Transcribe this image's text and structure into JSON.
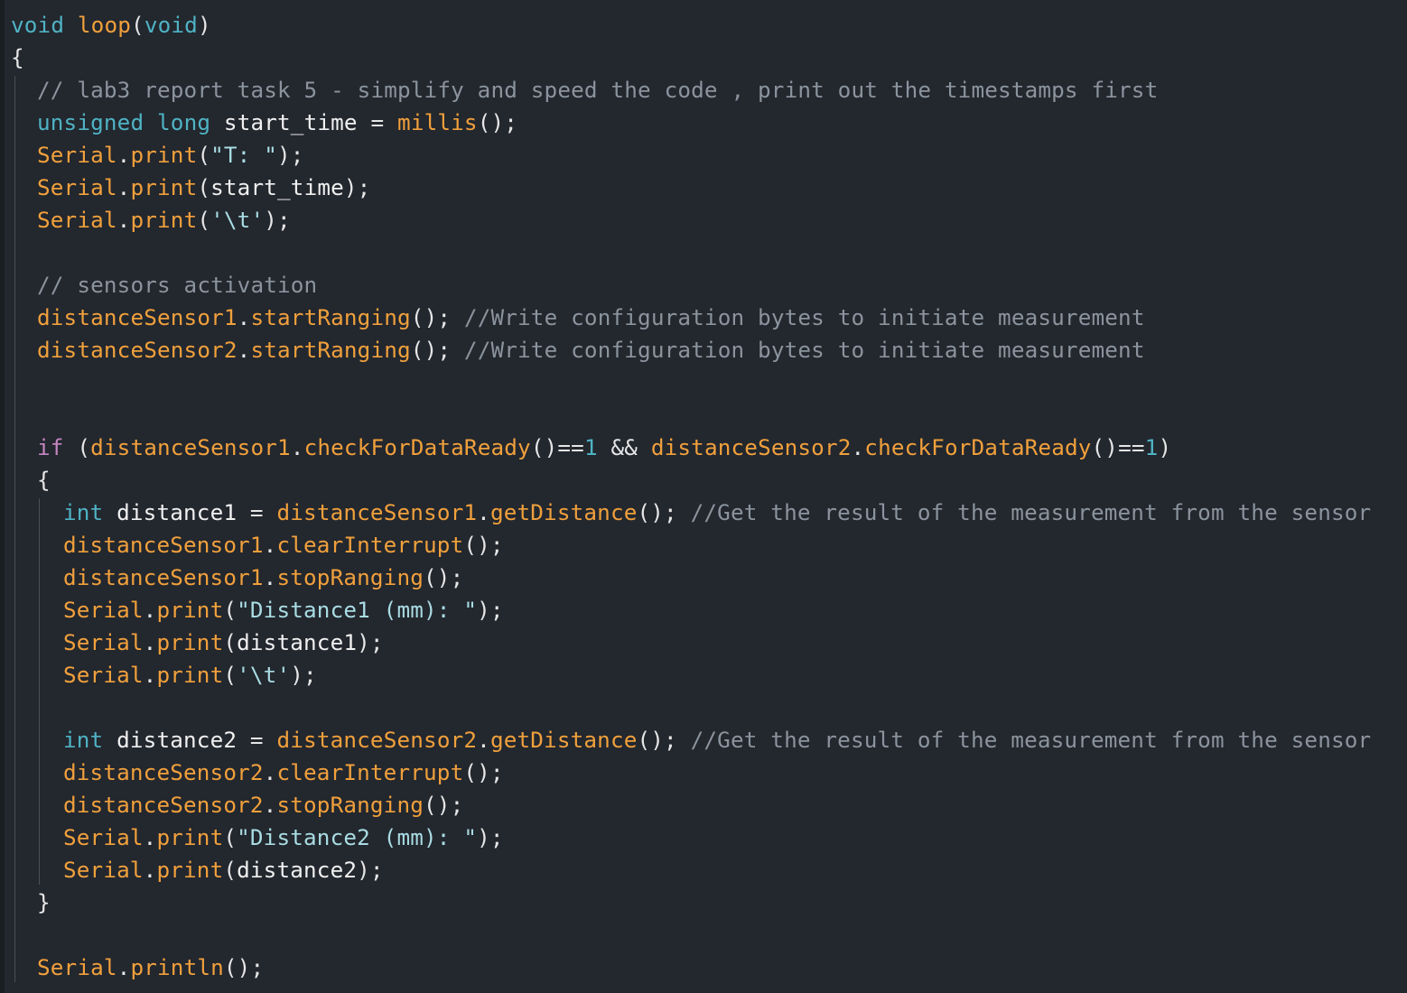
{
  "editor": {
    "language": "Arduino C++",
    "colors": {
      "background": "#23272e",
      "keyword": "#4fb3c4",
      "control": "#c586c0",
      "function": "#f0a03c",
      "comment": "#8b949e",
      "string": "#a9dce3",
      "number": "#4fb3c4",
      "plain": "#e6e6e6"
    },
    "lines": [
      {
        "indent": 0,
        "tokens": [
          [
            "kw",
            "void"
          ],
          [
            "ws",
            " "
          ],
          [
            "fn",
            "loop"
          ],
          [
            "pn",
            "("
          ],
          [
            "kw",
            "void"
          ],
          [
            "pn",
            ")"
          ]
        ]
      },
      {
        "indent": 0,
        "tokens": [
          [
            "pn",
            "{"
          ]
        ]
      },
      {
        "indent": 1,
        "tokens": [
          [
            "cm",
            "// lab3 report task 5 - simplify and speed the code , print out the timestamps first"
          ]
        ]
      },
      {
        "indent": 1,
        "tokens": [
          [
            "kw",
            "unsigned"
          ],
          [
            "ws",
            " "
          ],
          [
            "kw",
            "long"
          ],
          [
            "ws",
            " "
          ],
          [
            "id",
            "start_time"
          ],
          [
            "ws",
            " "
          ],
          [
            "op",
            "="
          ],
          [
            "ws",
            " "
          ],
          [
            "fn",
            "millis"
          ],
          [
            "pn",
            "();"
          ]
        ]
      },
      {
        "indent": 1,
        "tokens": [
          [
            "fn",
            "Serial"
          ],
          [
            "pn",
            "."
          ],
          [
            "fn",
            "print"
          ],
          [
            "pn",
            "("
          ],
          [
            "str",
            "\"T: \""
          ],
          [
            "pn",
            ");"
          ]
        ]
      },
      {
        "indent": 1,
        "tokens": [
          [
            "fn",
            "Serial"
          ],
          [
            "pn",
            "."
          ],
          [
            "fn",
            "print"
          ],
          [
            "pn",
            "("
          ],
          [
            "id",
            "start_time"
          ],
          [
            "pn",
            ");"
          ]
        ]
      },
      {
        "indent": 1,
        "tokens": [
          [
            "fn",
            "Serial"
          ],
          [
            "pn",
            "."
          ],
          [
            "fn",
            "print"
          ],
          [
            "pn",
            "("
          ],
          [
            "str",
            "'\\t'"
          ],
          [
            "pn",
            ");"
          ]
        ]
      },
      {
        "indent": 1,
        "tokens": []
      },
      {
        "indent": 1,
        "tokens": [
          [
            "cm",
            "// sensors activation"
          ]
        ]
      },
      {
        "indent": 1,
        "tokens": [
          [
            "fn",
            "distanceSensor1"
          ],
          [
            "pn",
            "."
          ],
          [
            "fn",
            "startRanging"
          ],
          [
            "pn",
            "();"
          ],
          [
            "ws",
            " "
          ],
          [
            "cm",
            "//Write configuration bytes to initiate measurement"
          ]
        ]
      },
      {
        "indent": 1,
        "tokens": [
          [
            "fn",
            "distanceSensor2"
          ],
          [
            "pn",
            "."
          ],
          [
            "fn",
            "startRanging"
          ],
          [
            "pn",
            "();"
          ],
          [
            "ws",
            " "
          ],
          [
            "cm",
            "//Write configuration bytes to initiate measurement"
          ]
        ]
      },
      {
        "indent": 1,
        "tokens": []
      },
      {
        "indent": 1,
        "tokens": []
      },
      {
        "indent": 1,
        "tokens": [
          [
            "ctl",
            "if"
          ],
          [
            "ws",
            " "
          ],
          [
            "pn",
            "("
          ],
          [
            "fn",
            "distanceSensor1"
          ],
          [
            "pn",
            "."
          ],
          [
            "fn",
            "checkForDataReady"
          ],
          [
            "pn",
            "()"
          ],
          [
            "op",
            "=="
          ],
          [
            "num",
            "1"
          ],
          [
            "ws",
            " "
          ],
          [
            "op",
            "&&"
          ],
          [
            "ws",
            " "
          ],
          [
            "fn",
            "distanceSensor2"
          ],
          [
            "pn",
            "."
          ],
          [
            "fn",
            "checkForDataReady"
          ],
          [
            "pn",
            "()"
          ],
          [
            "op",
            "=="
          ],
          [
            "num",
            "1"
          ],
          [
            "pn",
            ")"
          ]
        ]
      },
      {
        "indent": 1,
        "tokens": [
          [
            "pn",
            "{"
          ]
        ]
      },
      {
        "indent": 2,
        "tokens": [
          [
            "kw",
            "int"
          ],
          [
            "ws",
            " "
          ],
          [
            "id",
            "distance1"
          ],
          [
            "ws",
            " "
          ],
          [
            "op",
            "="
          ],
          [
            "ws",
            " "
          ],
          [
            "fn",
            "distanceSensor1"
          ],
          [
            "pn",
            "."
          ],
          [
            "fn",
            "getDistance"
          ],
          [
            "pn",
            "();"
          ],
          [
            "ws",
            " "
          ],
          [
            "cm",
            "//Get the result of the measurement from the sensor"
          ]
        ]
      },
      {
        "indent": 2,
        "tokens": [
          [
            "fn",
            "distanceSensor1"
          ],
          [
            "pn",
            "."
          ],
          [
            "fn",
            "clearInterrupt"
          ],
          [
            "pn",
            "();"
          ]
        ]
      },
      {
        "indent": 2,
        "tokens": [
          [
            "fn",
            "distanceSensor1"
          ],
          [
            "pn",
            "."
          ],
          [
            "fn",
            "stopRanging"
          ],
          [
            "pn",
            "();"
          ]
        ]
      },
      {
        "indent": 2,
        "tokens": [
          [
            "fn",
            "Serial"
          ],
          [
            "pn",
            "."
          ],
          [
            "fn",
            "print"
          ],
          [
            "pn",
            "("
          ],
          [
            "str",
            "\"Distance1 (mm): \""
          ],
          [
            "pn",
            ");"
          ]
        ]
      },
      {
        "indent": 2,
        "tokens": [
          [
            "fn",
            "Serial"
          ],
          [
            "pn",
            "."
          ],
          [
            "fn",
            "print"
          ],
          [
            "pn",
            "("
          ],
          [
            "id",
            "distance1"
          ],
          [
            "pn",
            ");"
          ]
        ]
      },
      {
        "indent": 2,
        "tokens": [
          [
            "fn",
            "Serial"
          ],
          [
            "pn",
            "."
          ],
          [
            "fn",
            "print"
          ],
          [
            "pn",
            "("
          ],
          [
            "str",
            "'\\t'"
          ],
          [
            "pn",
            ");"
          ]
        ]
      },
      {
        "indent": 2,
        "tokens": []
      },
      {
        "indent": 2,
        "tokens": [
          [
            "kw",
            "int"
          ],
          [
            "ws",
            " "
          ],
          [
            "id",
            "distance2"
          ],
          [
            "ws",
            " "
          ],
          [
            "op",
            "="
          ],
          [
            "ws",
            " "
          ],
          [
            "fn",
            "distanceSensor2"
          ],
          [
            "pn",
            "."
          ],
          [
            "fn",
            "getDistance"
          ],
          [
            "pn",
            "();"
          ],
          [
            "ws",
            " "
          ],
          [
            "cm",
            "//Get the result of the measurement from the sensor"
          ]
        ]
      },
      {
        "indent": 2,
        "tokens": [
          [
            "fn",
            "distanceSensor2"
          ],
          [
            "pn",
            "."
          ],
          [
            "fn",
            "clearInterrupt"
          ],
          [
            "pn",
            "();"
          ]
        ]
      },
      {
        "indent": 2,
        "tokens": [
          [
            "fn",
            "distanceSensor2"
          ],
          [
            "pn",
            "."
          ],
          [
            "fn",
            "stopRanging"
          ],
          [
            "pn",
            "();"
          ]
        ]
      },
      {
        "indent": 2,
        "tokens": [
          [
            "fn",
            "Serial"
          ],
          [
            "pn",
            "."
          ],
          [
            "fn",
            "print"
          ],
          [
            "pn",
            "("
          ],
          [
            "str",
            "\"Distance2 (mm): \""
          ],
          [
            "pn",
            ");"
          ]
        ]
      },
      {
        "indent": 2,
        "tokens": [
          [
            "fn",
            "Serial"
          ],
          [
            "pn",
            "."
          ],
          [
            "fn",
            "print"
          ],
          [
            "pn",
            "("
          ],
          [
            "id",
            "distance2"
          ],
          [
            "pn",
            ");"
          ]
        ]
      },
      {
        "indent": 1,
        "tokens": [
          [
            "pn",
            "}"
          ]
        ]
      },
      {
        "indent": 1,
        "tokens": []
      },
      {
        "indent": 1,
        "tokens": [
          [
            "fn",
            "Serial"
          ],
          [
            "pn",
            "."
          ],
          [
            "fn",
            "println"
          ],
          [
            "pn",
            "();"
          ]
        ]
      }
    ]
  }
}
